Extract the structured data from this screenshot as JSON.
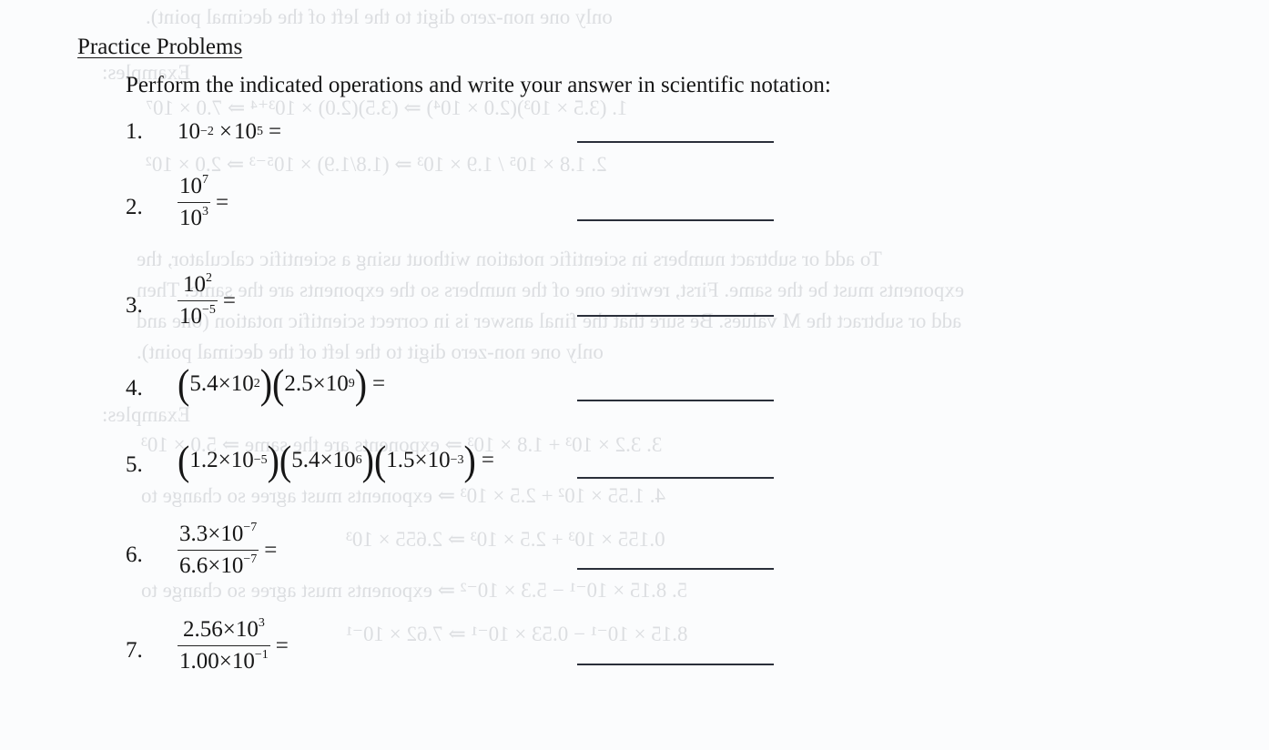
{
  "section_title": "Practice Problems",
  "instructions": "Perform the indicated operations and write your answer in scientific notation:",
  "problems": [
    {
      "number": "1.",
      "type": "product",
      "terms": [
        {
          "base": "10",
          "exp": "−2"
        },
        {
          "base": "10",
          "exp": "5"
        }
      ],
      "operator": "×",
      "equals": "=",
      "answer": ""
    },
    {
      "number": "2.",
      "type": "fraction",
      "numerator": {
        "base": "10",
        "exp": "7"
      },
      "denominator": {
        "base": "10",
        "exp": "3"
      },
      "equals": "=",
      "answer": ""
    },
    {
      "number": "3.",
      "type": "fraction",
      "numerator": {
        "base": "10",
        "exp": "2"
      },
      "denominator": {
        "base": "10",
        "exp": "−5"
      },
      "equals": "=",
      "answer": ""
    },
    {
      "number": "4.",
      "type": "paren-product",
      "factors": [
        {
          "m": "5.4",
          "exp": "2"
        },
        {
          "m": "2.5",
          "exp": "9"
        }
      ],
      "times": "×",
      "ten": "10",
      "equals": "=",
      "answer": ""
    },
    {
      "number": "5.",
      "type": "paren-product",
      "factors": [
        {
          "m": "1.2",
          "exp": "−5"
        },
        {
          "m": "5.4",
          "exp": "6"
        },
        {
          "m": "1.5",
          "exp": "−3"
        }
      ],
      "times": "×",
      "ten": "10",
      "equals": "=",
      "answer": ""
    },
    {
      "number": "6.",
      "type": "sci-fraction",
      "numerator": {
        "m": "3.3",
        "exp": "−7"
      },
      "denominator": {
        "m": "6.6",
        "exp": "−7"
      },
      "times": "×",
      "ten": "10",
      "equals": "=",
      "answer": ""
    },
    {
      "number": "7.",
      "type": "sci-fraction",
      "numerator": {
        "m": "2.56",
        "exp": "3"
      },
      "denominator": {
        "m": "1.00",
        "exp": "−1"
      },
      "times": "×",
      "ten": "10",
      "equals": "=",
      "answer": ""
    }
  ],
  "bleed_through": {
    "lines": [
      "only one non-zero digit to the left of the decimal point).",
      "Examples:",
      "1.   (3.5 × 10³)(2.0 × 10⁴)   ⇒   (3.5)(2.0) × 10³⁺⁴   ⇒   7.0 × 10⁷",
      "2.   1.8 × 10⁵ / 1.9 × 10³   ⇒   (1.8/1.9) × 10⁵⁻³   ⇒   2.0 × 10²",
      "To add or subtract numbers in scientific notation without using a scientific calculator, the",
      "exponents must be the same. First, rewrite one of the numbers so the exponents are the same. Then",
      "add or subtract the M values. Be sure that the final answer is in correct scientific notation (one and",
      "only one non-zero digit to the left of the decimal point).",
      "Examples:",
      "3.   3.2 × 10³ + 1.8 × 10³   ⇒   exponents are the same   ⇒   5.0 × 10³",
      "4.   1.55 × 10² + 2.5 × 10³   ⇒   exponents must agree so change to",
      "0.155 × 10³ + 2.5 × 10³   ⇒   2.655 × 10³",
      "5.   8.15 × 10⁻¹ − 5.3 × 10⁻²   ⇒   exponents must agree so change to",
      "8.15 × 10⁻¹ − 0.53 × 10⁻¹   ⇒   7.62 × 10⁻¹"
    ]
  }
}
